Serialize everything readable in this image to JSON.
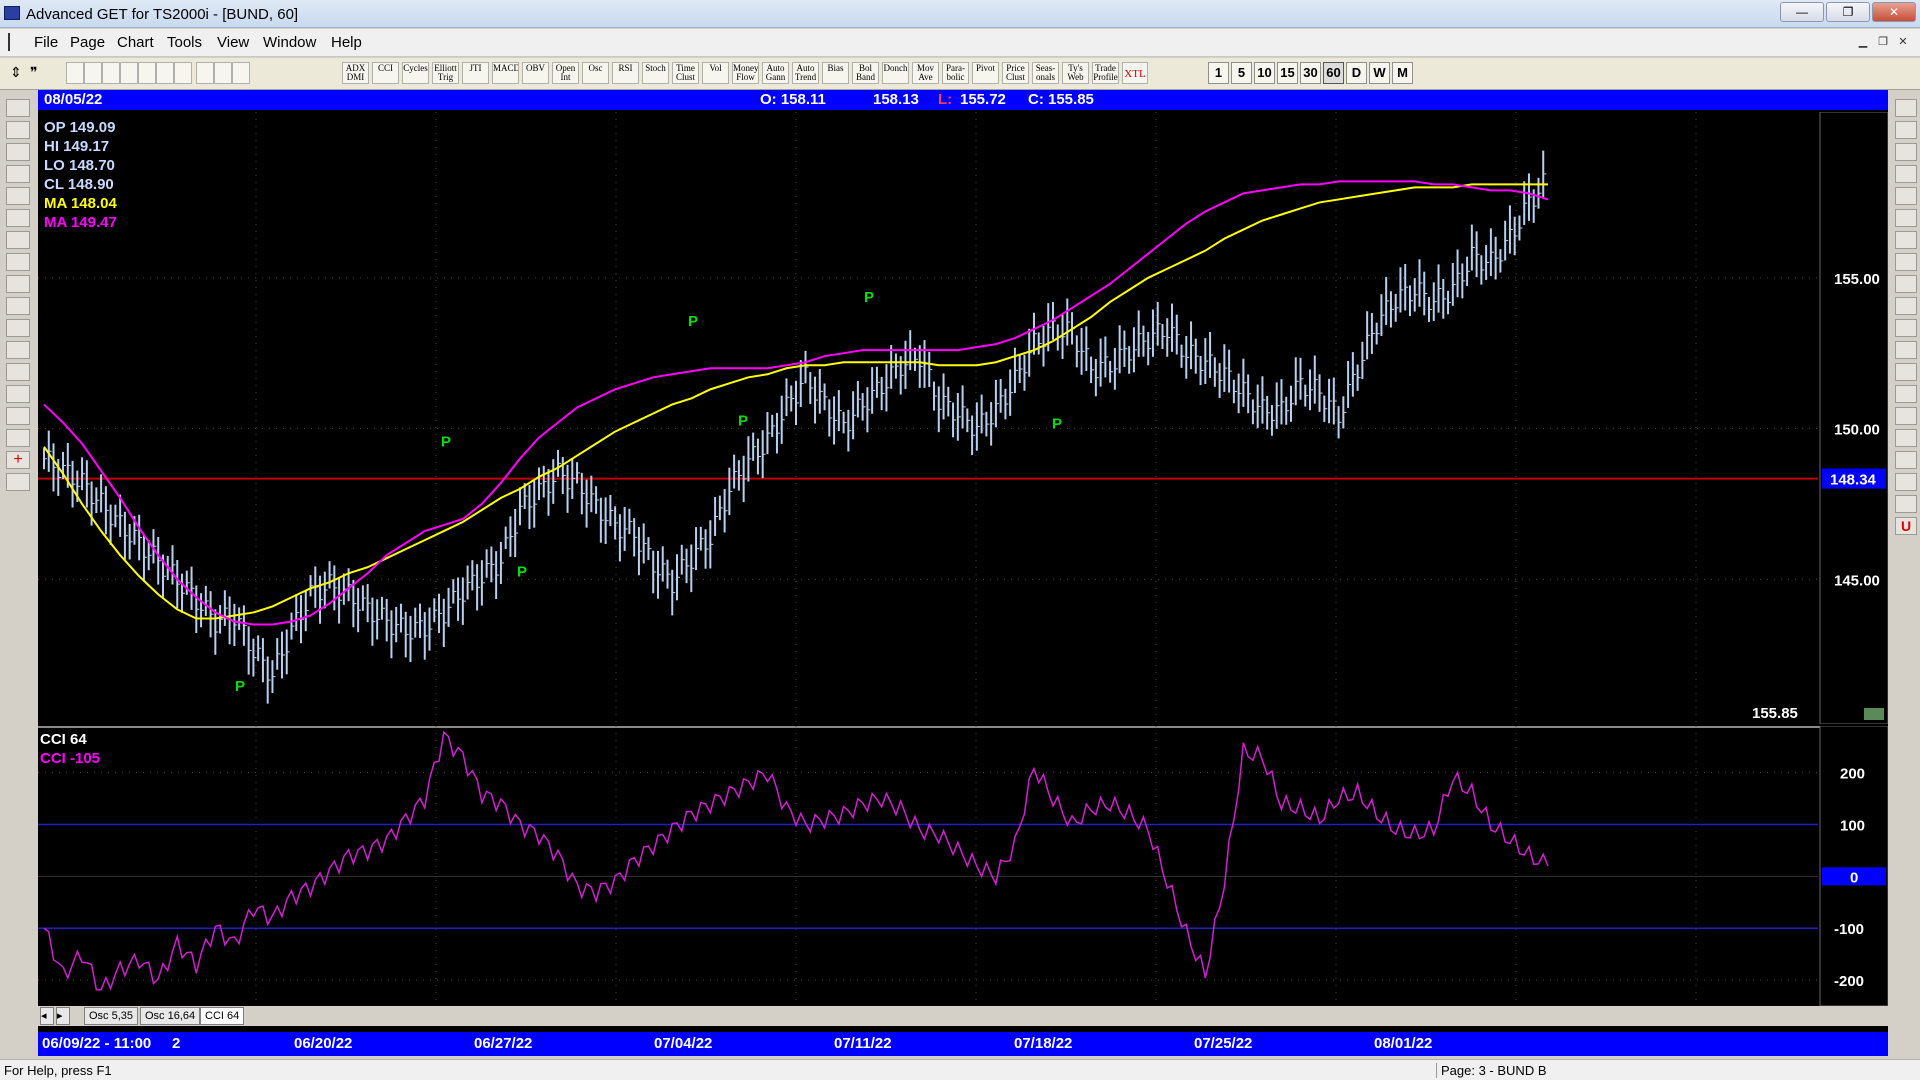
{
  "window": {
    "title": "Advanced GET for TS2000i - [BUND, 60]",
    "min": "—",
    "max": "❐",
    "close": "✕"
  },
  "menu": [
    "File",
    "Page",
    "Chart",
    "Tools",
    "View",
    "Window",
    "Help"
  ],
  "toolbar": {
    "studies": [
      "ADX DMI",
      "CCI",
      "Cycles",
      "Elliott Trig",
      "JTI",
      "MACD",
      "OBV",
      "Open Int",
      "Osc",
      "RSI",
      "Stoch",
      "Time Clust",
      "Vol",
      "Money Flow",
      "Auto Gann",
      "Auto Trend",
      "Bias",
      "Bol Band",
      "Donch",
      "Mov Ave",
      "Para- bolic",
      "Pivot",
      "Price Clust",
      "Seas- onals",
      "Ty's Web",
      "Trade Profile",
      "XTL"
    ],
    "timeframes": [
      "1",
      "5",
      "10",
      "15",
      "30",
      "60",
      "D",
      "W",
      "M"
    ],
    "selected_timeframe": "60"
  },
  "header": {
    "date": "08/05/22",
    "open": "O: 158.11",
    "high": "158.13",
    "low_label": "L:",
    "low": "155.72",
    "close": "C: 155.85"
  },
  "legend": {
    "op": "OP  149.09",
    "hi": "HI   149.17",
    "lo": "LO   148.70",
    "cl": "CL   148.90",
    "ma1": "MA  148.04",
    "ma2": "MA  149.47",
    "colors": {
      "text": "#c8d8ff",
      "ma1": "#ffff00",
      "ma2": "#ff00ff"
    }
  },
  "price_axis": {
    "ticks": [
      "155.00",
      "150.00",
      "145.00"
    ],
    "marker": "148.34",
    "last": "155.85"
  },
  "cci": {
    "title": "CCI 64",
    "value_label": "CCI  -105",
    "ticks": [
      "200",
      "100",
      "0",
      "-100",
      "-200"
    ]
  },
  "osc_tabs": [
    "Osc 5,35",
    "Osc 16,64",
    "CCI 64"
  ],
  "time_axis": {
    "start": "06/09/22 - 11:00",
    "start_suffix": "2",
    "labels": [
      "06/20/22",
      "06/27/22",
      "07/04/22",
      "07/11/22",
      "07/18/22",
      "07/25/22",
      "08/01/22"
    ]
  },
  "status": {
    "help": "For Help, press F1",
    "page": "Page: 3 - BUND B"
  },
  "chart_data": [
    {
      "type": "line",
      "title": "BUND, 60",
      "ylim": [
        140.2,
        160.5
      ],
      "x": [
        0,
        10,
        20,
        30,
        40,
        50,
        60,
        70,
        80,
        90,
        100,
        110,
        120,
        130,
        140,
        150,
        160,
        170,
        180,
        190,
        200,
        210,
        220,
        230,
        240,
        250,
        260,
        270,
        280,
        290,
        300,
        310,
        320,
        330,
        340,
        350,
        360,
        370,
        380,
        390,
        400,
        410,
        420,
        430,
        440,
        450,
        460,
        470,
        480,
        490,
        500,
        510,
        520,
        530,
        540,
        550,
        560,
        570,
        580,
        590,
        600,
        610,
        620,
        630,
        640,
        650,
        660,
        670,
        680,
        690,
        700,
        710,
        720,
        730,
        740,
        750,
        760,
        770,
        780,
        790
      ],
      "series": [
        {
          "name": "Close",
          "values": [
            149.0,
            148.6,
            148.2,
            147.5,
            146.8,
            146.2,
            145.6,
            145.0,
            144.3,
            143.6,
            143.8,
            142.6,
            141.8,
            143.3,
            144.5,
            144.8,
            144.5,
            144.0,
            143.6,
            143.3,
            143.4,
            143.9,
            144.6,
            145.1,
            145.6,
            147.3,
            147.9,
            148.5,
            148.2,
            147.4,
            146.8,
            146.5,
            145.5,
            144.9,
            145.7,
            146.4,
            148.0,
            148.9,
            149.6,
            150.7,
            151.7,
            150.8,
            150.1,
            150.8,
            151.4,
            152.1,
            152.4,
            150.9,
            150.5,
            150.0,
            150.6,
            151.6,
            152.8,
            153.3,
            153.2,
            152.0,
            152.1,
            152.6,
            153.0,
            153.3,
            152.5,
            152.2,
            151.8,
            151.2,
            150.6,
            150.6,
            151.5,
            151.2,
            150.4,
            152.0,
            153.5,
            154.3,
            154.6,
            154.2,
            154.6,
            155.7,
            155.5,
            156.3,
            157.5,
            158.3
          ]
        },
        {
          "name": "MA",
          "values": [
            149.4,
            148.5,
            147.5,
            146.6,
            145.8,
            145.1,
            144.5,
            144.0,
            143.7,
            143.7,
            143.8,
            143.9,
            144.1,
            144.4,
            144.7,
            144.9,
            145.2,
            145.4,
            145.7,
            146.0,
            146.3,
            146.6,
            146.9,
            147.3,
            147.7,
            148.0,
            148.4,
            148.7,
            149.1,
            149.5,
            149.9,
            150.2,
            150.5,
            150.8,
            151.0,
            151.3,
            151.5,
            151.7,
            151.8,
            152.0,
            152.1,
            152.1,
            152.2,
            152.2,
            152.2,
            152.2,
            152.2,
            152.1,
            152.1,
            152.1,
            152.2,
            152.4,
            152.6,
            152.9,
            153.3,
            153.7,
            154.2,
            154.6,
            155.0,
            155.3,
            155.6,
            155.9,
            156.3,
            156.6,
            156.9,
            157.1,
            157.3,
            157.5,
            157.6,
            157.7,
            157.8,
            157.9,
            158.0,
            158.0,
            158.0,
            158.1,
            158.1,
            158.1,
            158.1,
            158.1
          ]
        },
        {
          "name": "MA",
          "values": [
            150.8,
            150.2,
            149.5,
            148.6,
            147.7,
            146.7,
            145.8,
            145.0,
            144.4,
            143.9,
            143.6,
            143.5,
            143.5,
            143.6,
            143.8,
            144.2,
            144.7,
            145.2,
            145.8,
            146.2,
            146.6,
            146.8,
            147.0,
            147.5,
            148.2,
            149.0,
            149.7,
            150.2,
            150.7,
            151.0,
            151.3,
            151.5,
            151.7,
            151.8,
            151.9,
            152.0,
            152.0,
            152.0,
            152.0,
            152.1,
            152.2,
            152.4,
            152.5,
            152.6,
            152.6,
            152.6,
            152.6,
            152.6,
            152.6,
            152.7,
            152.8,
            153.0,
            153.3,
            153.6,
            154.0,
            154.4,
            154.8,
            155.3,
            155.8,
            156.3,
            156.8,
            157.2,
            157.5,
            157.8,
            157.9,
            158.0,
            158.1,
            158.1,
            158.2,
            158.2,
            158.2,
            158.2,
            158.2,
            158.1,
            158.1,
            158.0,
            157.9,
            157.9,
            157.8,
            157.6
          ]
        }
      ],
      "pivots": [
        {
          "label": "P",
          "value": 141.3
        },
        {
          "label": "P",
          "value": 149.4
        },
        {
          "label": "P",
          "value": 145.1
        },
        {
          "label": "P",
          "value": 153.4
        },
        {
          "label": "P",
          "value": 150.1
        },
        {
          "label": "P",
          "value": 154.2
        },
        {
          "label": "P",
          "value": 150.0
        }
      ],
      "hline": 148.34
    },
    {
      "type": "line",
      "title": "CCI 64",
      "ylim": [
        -250,
        290
      ],
      "x": [
        0,
        10,
        20,
        30,
        40,
        50,
        60,
        70,
        80,
        90,
        100,
        110,
        120,
        130,
        140,
        150,
        160,
        170,
        180,
        190,
        200,
        210,
        220,
        230,
        240,
        250,
        260,
        270,
        280,
        290,
        300,
        310,
        320,
        330,
        340,
        350,
        360,
        370,
        380,
        390,
        400,
        410,
        420,
        430,
        440,
        450,
        460,
        470,
        480,
        490,
        500,
        510,
        520,
        530,
        540,
        550,
        560,
        570,
        580,
        590,
        600,
        610,
        620,
        630,
        640,
        650,
        660,
        670,
        680,
        690,
        700,
        710,
        720,
        730,
        740,
        750,
        760,
        770,
        780,
        790
      ],
      "series": [
        {
          "name": "CCI",
          "values": [
            -100,
            -190,
            -150,
            -220,
            -180,
            -160,
            -200,
            -130,
            -170,
            -100,
            -130,
            -60,
            -80,
            -40,
            -20,
            10,
            40,
            50,
            70,
            110,
            150,
            270,
            230,
            160,
            140,
            100,
            80,
            40,
            -20,
            -30,
            -10,
            30,
            60,
            90,
            120,
            140,
            160,
            180,
            200,
            130,
            100,
            110,
            120,
            140,
            150,
            130,
            90,
            80,
            50,
            20,
            0,
            60,
            210,
            150,
            100,
            130,
            140,
            120,
            90,
            -10,
            -110,
            -190,
            -10,
            240,
            230,
            140,
            130,
            110,
            150,
            160,
            120,
            90,
            80,
            90,
            190,
            160,
            100,
            70,
            40,
            20
          ]
        }
      ],
      "hlines": [
        100,
        0,
        -100
      ]
    }
  ]
}
